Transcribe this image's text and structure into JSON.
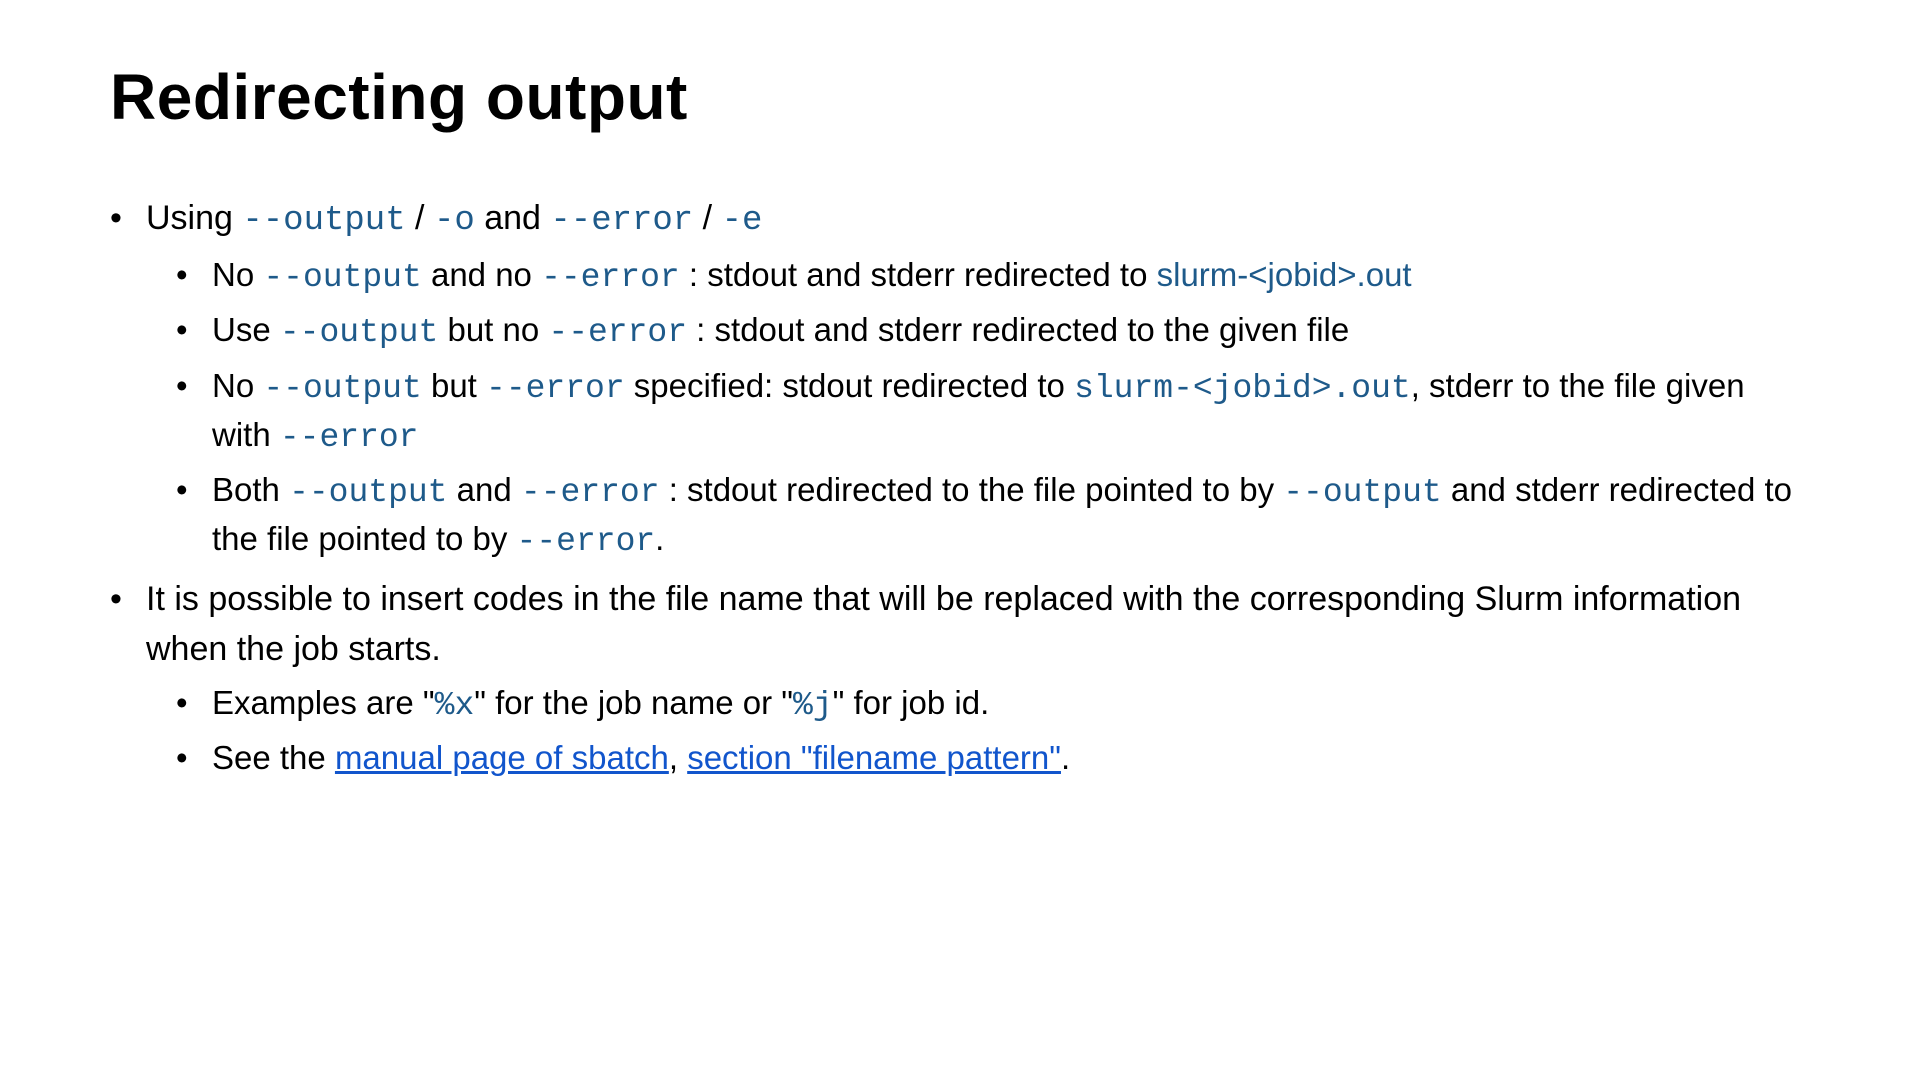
{
  "title": "Redirecting output",
  "b1_t1": "Using ",
  "b1_c1": "--output",
  "b1_t2": " / ",
  "b1_c2": "-o",
  "b1_t3": " and ",
  "b1_c3": "--error",
  "b1_t4": " / ",
  "b1_c4": "-e",
  "s1a_t1": "No ",
  "s1a_c1": "--output",
  "s1a_t2": " and no ",
  "s1a_c2": "--error",
  "s1a_t3": " : stdout and stderr redirected to ",
  "s1a_f1": "slurm-<jobid>.out",
  "s1b_t1": "Use ",
  "s1b_c1": "--output",
  "s1b_t2": " but no ",
  "s1b_c2": "--error",
  "s1b_t3": " : stdout and stderr redirected to the given file",
  "s1c_t1": "No ",
  "s1c_c1": "--output",
  "s1c_t2": " but ",
  "s1c_c2": "--error",
  "s1c_t3": " specified: stdout redirected to ",
  "s1c_f1": "slurm-<jobid>.out",
  "s1c_t4": ", stderr to the file given with ",
  "s1c_c3": "--error",
  "s1d_t1": "Both ",
  "s1d_c1": "--output",
  "s1d_t2": " and ",
  "s1d_c2": "--error",
  "s1d_t3": " : stdout redirected to the file pointed to by ",
  "s1d_c3": "--output",
  "s1d_t4": " and stderr redirected to the file pointed to by ",
  "s1d_c4": "--error",
  "s1d_t5": ".",
  "b2_t1": "It is possible to insert codes in the file name that will be replaced with the corresponding Slurm information when the job starts.",
  "s2a_t1": "Examples are \"",
  "s2a_c1": "%x",
  "s2a_t2": "\" for the job name or \"",
  "s2a_c2": "%j",
  "s2a_t3": "\" for job id.",
  "s2b_t1": "See the ",
  "s2b_l1": "manual page of sbatch",
  "s2b_t2": ", ",
  "s2b_l2": "section \"filename pattern\"",
  "s2b_t3": "."
}
